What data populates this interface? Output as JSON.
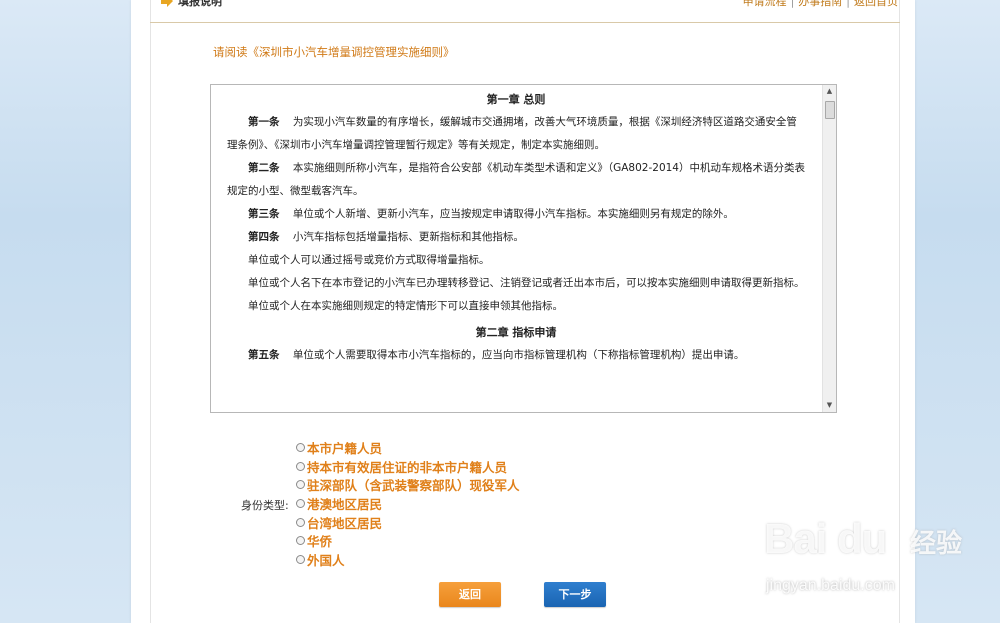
{
  "header": {
    "title": "填报说明",
    "links": [
      "申请流程",
      "办事指南",
      "返回首页"
    ],
    "link_separator": "|"
  },
  "read_link": "请阅读《深圳市小汽车增量调控管理实施细则》",
  "document": {
    "chapter1": "第一章 总则",
    "art1_title": "第一条",
    "art1_text": "为实现小汽车数量的有序增长，缓解城市交通拥堵，改善大气环境质量，根据《深圳经济特区道路交通安全管理条例》、《深圳市小汽车增量调控管理暂行规定》等有关规定，制定本实施细则。",
    "art2_title": "第二条",
    "art2_text": "本实施细则所称小汽车，是指符合公安部《机动车类型术语和定义》（GA802-2014）中机动车规格术语分类表规定的小型、微型载客汽车。",
    "art3_title": "第三条",
    "art3_text": "单位或个人新增、更新小汽车，应当按规定申请取得小汽车指标。本实施细则另有规定的除外。",
    "art4_title": "第四条",
    "art4_text": "小汽车指标包括增量指标、更新指标和其他指标。",
    "p1": "单位或个人可以通过摇号或竞价方式取得增量指标。",
    "p2": "单位或个人名下在本市登记的小汽车已办理转移登记、注销登记或者迁出本市后，可以按本实施细则申请取得更新指标。",
    "p3": "单位或个人在本实施细则规定的特定情形下可以直接申领其他指标。",
    "chapter2": "第二章 指标申请",
    "art5_title": "第五条",
    "art5_text": "单位或个人需要取得本市小汽车指标的，应当向市指标管理机构（下称指标管理机构）提出申请。"
  },
  "identity": {
    "label": "身份类型:",
    "options": [
      "本市户籍人员",
      "持本市有效居住证的非本市户籍人员",
      "驻深部队（含武装警察部队）现役军人",
      "港澳地区居民",
      "台湾地区居民",
      "华侨",
      "外国人"
    ]
  },
  "buttons": {
    "back": "返回",
    "next": "下一步"
  },
  "watermark": {
    "logo": "Bai du",
    "text": "经验",
    "url": "jingyan.baidu.com"
  },
  "colors": {
    "accent_orange": "#e0801a",
    "link_orange": "#c07a1b",
    "next_blue": "#1a64b2"
  }
}
